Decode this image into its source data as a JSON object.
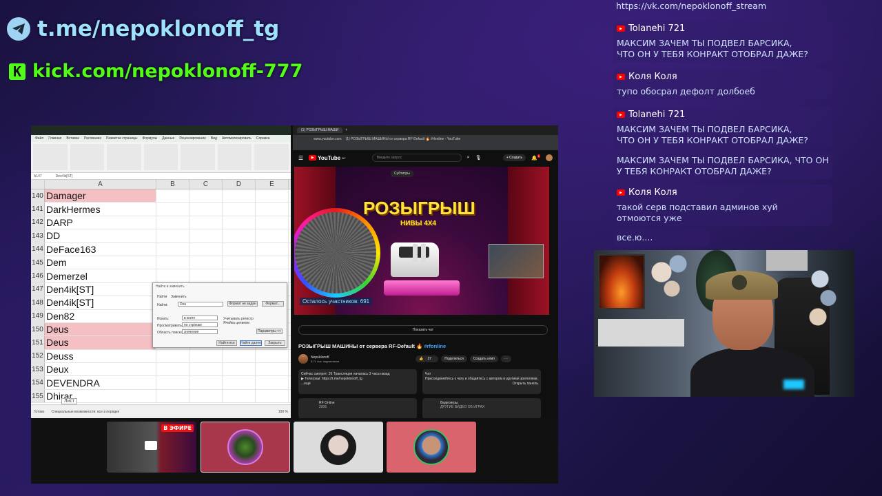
{
  "overlay": {
    "telegram_link": "t.me/nepoklonoff_tg",
    "kick_link": "kick.com/nepoklonoff-777",
    "telegram_icon": "telegram-plane-icon",
    "kick_icon": "kick-k-icon",
    "kick_letter": "K",
    "telegram_color": "#9ee0ff",
    "kick_color": "#53fc18"
  },
  "chat": {
    "top_url": "https://vk.com/nepoklonoff_stream",
    "messages": [
      {
        "user": "Tolanehi 721",
        "text": "МАКСИМ ЗАЧЕМ ТЫ ПОДВЕЛ БАРСИКА, ЧТО ОН У ТЕБЯ КОНРАКТ ОТОБРАЛ ДАЖЕ?"
      },
      {
        "user": "Коля Коля",
        "text": "тупо обосрал дефолт долбоеб"
      },
      {
        "user": "Tolanehi 721",
        "text": "МАКСИМ ЗАЧЕМ ТЫ ПОДВЕЛ БАРСИКА, ЧТО ОН У ТЕБЯ КОНРАКТ ОТОБРАЛ ДАЖЕ?"
      },
      {
        "user": "",
        "text": "МАКСИМ ЗАЧЕМ ТЫ ПОДВЕЛ БАРСИКА, ЧТО ОН У ТЕБЯ КОНРАКТ ОТОБРАЛ ДАЖЕ?"
      },
      {
        "user": "Коля Коля",
        "text": "такой серв подставил админов хуй отмоются уже"
      },
      {
        "user": "",
        "text": "все.ю...."
      }
    ]
  },
  "excel": {
    "name_box": "A147",
    "formula": "Den4ik[ST]",
    "menu": [
      "Файл",
      "Главная",
      "Вставка",
      "Рисование",
      "Разметка страницы",
      "Формулы",
      "Данные",
      "Рецензирование",
      "Вид",
      "Автоматизировать",
      "Справка"
    ],
    "columns": [
      "A",
      "B",
      "C",
      "D",
      "E"
    ],
    "rows": [
      {
        "num": "140",
        "value": "Damager",
        "highlight": true
      },
      {
        "num": "141",
        "value": "DarkHermes",
        "highlight": false
      },
      {
        "num": "142",
        "value": "DARP",
        "highlight": false
      },
      {
        "num": "143",
        "value": "DD",
        "highlight": false
      },
      {
        "num": "144",
        "value": "DeFace163",
        "highlight": false
      },
      {
        "num": "145",
        "value": "Dem",
        "highlight": false
      },
      {
        "num": "146",
        "value": "Demerzel",
        "highlight": false
      },
      {
        "num": "147",
        "value": "Den4ik[ST]",
        "highlight": false
      },
      {
        "num": "148",
        "value": "Den4ik[ST]",
        "highlight": false
      },
      {
        "num": "149",
        "value": "Den82",
        "highlight": false
      },
      {
        "num": "150",
        "value": "Deus",
        "highlight": true
      },
      {
        "num": "151",
        "value": "Deus",
        "highlight": true
      },
      {
        "num": "152",
        "value": "Deuss",
        "highlight": false
      },
      {
        "num": "153",
        "value": "Deux",
        "highlight": false
      },
      {
        "num": "154",
        "value": "DEVENDRA",
        "highlight": false
      },
      {
        "num": "155",
        "value": "Dhirar",
        "highlight": false
      }
    ],
    "sheet_tab": "Лист",
    "status_ready": "Готово",
    "status_access": "Специальные возможности: все в порядке",
    "zoom": "190 %",
    "find_dialog": {
      "title": "Найти и заменить",
      "tab_find": "Найти",
      "tab_replace": "Заменить",
      "find_label": "Найти:",
      "find_value": "Deu",
      "format_status": "Формат не задан",
      "format_btn": "Формат...",
      "within_label": "Искать:",
      "within_value": "в книге",
      "search_label": "Просматривать:",
      "search_value": "по строкам",
      "lookin_label": "Область поиска:",
      "lookin_value": "значения",
      "match_case": "Учитывать регистр",
      "match_entire": "Ячейка целиком",
      "options_btn": "Параметры <<",
      "find_all": "Найти все",
      "find_next": "Найти далее",
      "close": "Закрыть"
    }
  },
  "browser": {
    "tab_title": "(1) РОЗЫГРЫШ МАШИ",
    "url": "www.youtube.com",
    "page_title": "(1) РОЗЫГРЫШ МАШИНЫ от сервера RF-Default 🔥 #rfonline - YouTube",
    "search_placeholder": "Введите запрос",
    "create_label": "+ Создать",
    "notif_count": "1",
    "logo_text": "YouTube",
    "logo_region": "BY"
  },
  "video": {
    "subtitles_pill": "Субтитры",
    "title_big": "РОЗЫГРЫШ",
    "subtitle_big": "НИВЫ 4X4",
    "participants_left": "Осталось участников: 691",
    "show_chat": "Показать чат",
    "title": "РОЗЫГРЫШ МАШИНЫ от сервера RF-Default 🔥",
    "hashtag": "#rfonline",
    "channel": "Nepoklonoff",
    "subscribers": "8,71 тыс. подписчиков",
    "likes": "27",
    "share": "Поделиться",
    "clip": "Создать клип",
    "watching": "Сейчас смотрят: 26  Трансляция началась 3 часа назад",
    "telegram_line": "▶ Телеграм: https://t.me/nepoklonoff_tg",
    "more": "...ещё",
    "chat_title": "Чат",
    "chat_desc": "Присоединяйтесь к чату и общайтесь с автором и другими зрителями.",
    "open_panel": "Открыть панель",
    "rf_title": "RF Online",
    "rf_year": "2006",
    "games_title": "Видеоигры",
    "games_sub": "ДРУГИЕ ВИДЕО ОБ ИГРАХ"
  },
  "taskbar": {
    "live_badge": "В ЭФИРЕ"
  }
}
